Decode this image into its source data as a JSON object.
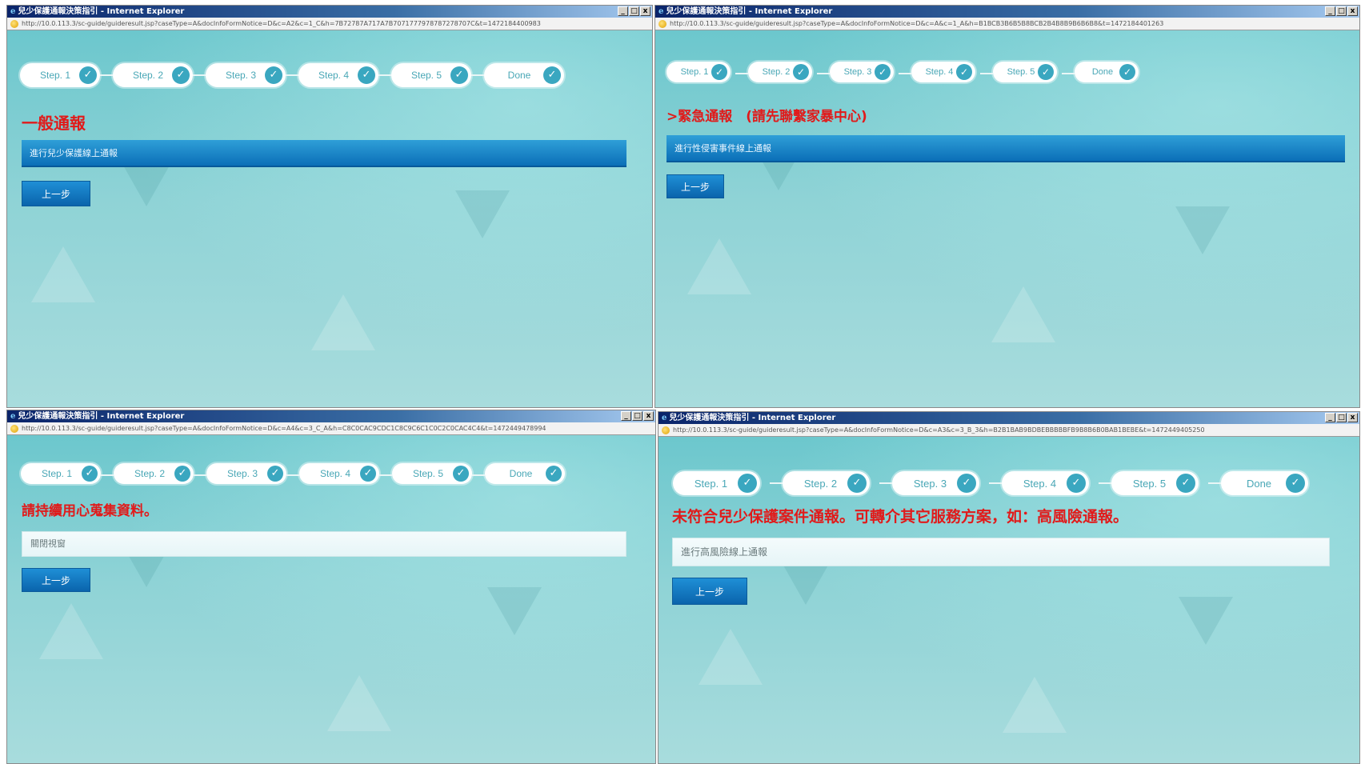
{
  "windows": [
    {
      "title": "兒少保護通報決策指引 - Internet Explorer",
      "url": "http://10.0.113.3/sc-guide/guideresult.jsp?caseType=A&docInfoFormNotice=D&c=A2&c=1_C&h=7B72787A717A7B7071777978787278707C&t=1472184400983",
      "steps": [
        "Step. 1",
        "Step. 2",
        "Step. 3",
        "Step. 4",
        "Step. 5",
        "Done"
      ],
      "heading": "一般通報",
      "bar_text": "進行兒少保護線上通報",
      "back_button": "上一步"
    },
    {
      "title": "兒少保護通報決策指引 - Internet Explorer",
      "url": "http://10.0.113.3/sc-guide/guideresult.jsp?caseType=A&docInfoFormNotice=D&c=A&c=1_A&h=B1BCB3B6B5B8BCB2B4B8B9B6B6B8&t=1472184401263",
      "steps": [
        "Step. 1",
        "Step. 2",
        "Step. 3",
        "Step. 4",
        "Step. 5",
        "Done"
      ],
      "heading": ">緊急通報　(請先聯繫家暴中心)",
      "bar_text": "進行性侵害事件線上通報",
      "back_button": "上一步"
    },
    {
      "title": "兒少保護通報決策指引 - Internet Explorer",
      "url": "http://10.0.113.3/sc-guide/guideresult.jsp?caseType=A&docInfoFormNotice=D&c=A4&c=3_C_A&h=C8C0CAC9CDC1C8C9C6C1C0C2C0CAC4C4&t=1472449478994",
      "steps": [
        "Step. 1",
        "Step. 2",
        "Step. 3",
        "Step. 4",
        "Step. 5",
        "Done"
      ],
      "heading": "請持續用心蒐集資料。",
      "bar_text": "關閉視窗",
      "back_button": "上一步"
    },
    {
      "title": "兒少保護通報決策指引 - Internet Explorer",
      "url": "http://10.0.113.3/sc-guide/guideresult.jsp?caseType=A&docInfoFormNotice=D&c=A3&c=3_B_3&h=B2B1BAB9BDBEBBBBBFB9B8B6B0BAB1BEBE&t=1472449405250",
      "steps": [
        "Step. 1",
        "Step. 2",
        "Step. 3",
        "Step. 4",
        "Step. 5",
        "Done"
      ],
      "heading": "未符合兒少保護案件通報。可轉介其它服務方案，如：高風險通報。",
      "bar_text": "進行高風險線上通報",
      "back_button": "上一步"
    }
  ],
  "window_buttons": [
    "_",
    "□",
    "x"
  ],
  "colors": {
    "heading": "#e11a1a",
    "accent_blue": "#0b6fb8",
    "step_check": "#3aa7c0",
    "background": "#8fd3d6"
  },
  "icons": [
    "ie-icon",
    "page-icon",
    "check-icon"
  ]
}
